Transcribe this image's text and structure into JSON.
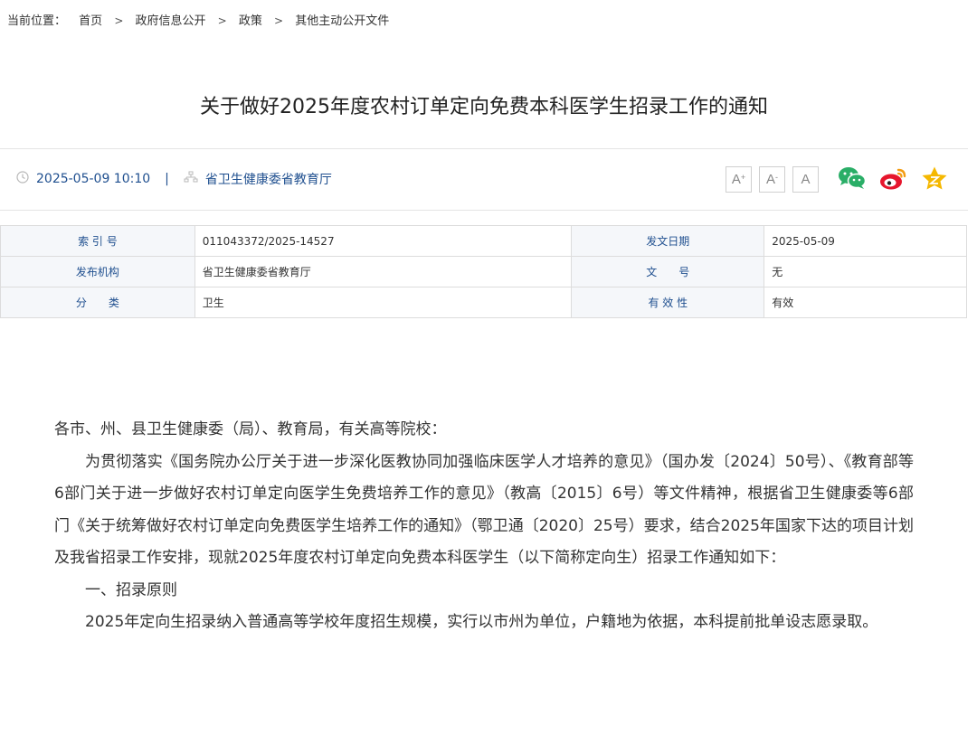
{
  "breadcrumb": {
    "lead": "当前位置：",
    "items": [
      "首页",
      "政府信息公开",
      "政策",
      "其他主动公开文件"
    ],
    "separator": ">"
  },
  "title": "关于做好2025年度农村订单定向免费本科医学生招录工作的通知",
  "meta": {
    "date": "2025-05-09 10:10",
    "divider": "|",
    "source": "省卫生健康委省教育厅"
  },
  "font_controls": {
    "increase": "A",
    "decrease": "A",
    "reset": "A"
  },
  "share": {
    "wechat_icon": "wechat-icon",
    "weibo_icon": "weibo-icon",
    "favorite_icon": "star-icon",
    "colors": {
      "wechat": "#2aae67",
      "weibo": "#e6162d",
      "favorite": "#f5b800"
    }
  },
  "info_table": {
    "rows": [
      {
        "k1": "索 引 号",
        "v1": "011043372/2025-14527",
        "k2": "发文日期",
        "v2": "2025-05-09"
      },
      {
        "k1": "发布机构",
        "v1": "省卫生健康委省教育厅",
        "k2": "文　　号",
        "v2": "无"
      },
      {
        "k1": "分　　类",
        "v1": "卫生",
        "k2": "有 效 性",
        "v2": "有效"
      }
    ]
  },
  "content": {
    "paragraphs": [
      "各市、州、县卫生健康委（局）、教育局，有关高等院校：",
      "为贯彻落实《国务院办公厅关于进一步深化医教协同加强临床医学人才培养的意见》（国办发〔2024〕50号）、《教育部等6部门关于进一步做好农村订单定向医学生免费培养工作的意见》（教高〔2015〕6号）等文件精神，根据省卫生健康委等6部门《关于统筹做好农村订单定向免费医学生培养工作的通知》（鄂卫通〔2020〕25号）要求，结合2025年国家下达的项目计划及我省招录工作安排，现就2025年度农村订单定向免费本科医学生（以下简称定向生）招录工作通知如下：",
      "一、招录原则",
      "2025年定向生招录纳入普通高等学校年度招生规模，实行以市州为单位，户籍地为依据，本科提前批单设志愿录取。"
    ]
  }
}
